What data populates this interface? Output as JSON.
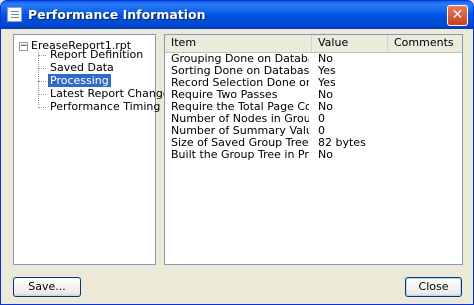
{
  "window": {
    "title": "Performance Information",
    "close_glyph": "✕"
  },
  "tree": {
    "root": {
      "label": "EreaseReport1.rpt",
      "expander": "−"
    },
    "items": [
      {
        "label": "Report Definition",
        "selected": false
      },
      {
        "label": "Saved Data",
        "selected": false
      },
      {
        "label": "Processing",
        "selected": true
      },
      {
        "label": "Latest Report Changes",
        "selected": false
      },
      {
        "label": "Performance Timing",
        "selected": false
      }
    ]
  },
  "grid": {
    "columns": [
      "Item",
      "Value",
      "Comments"
    ],
    "rows": [
      {
        "item": "Grouping Done on Database Server",
        "value": "No"
      },
      {
        "item": "Sorting Done on Database Server",
        "value": "Yes"
      },
      {
        "item": "Record Selection Done on Databa...",
        "value": "Yes"
      },
      {
        "item": "Require Two Passes",
        "value": "No"
      },
      {
        "item": "Require the Total Page Count",
        "value": "No"
      },
      {
        "item": "Number of Nodes in Group Tree",
        "value": "0"
      },
      {
        "item": "Number of Summary Values",
        "value": "0"
      },
      {
        "item": "Size of Saved Group Tree",
        "value": "82  bytes"
      },
      {
        "item": "Built the Group Tree in Progress",
        "value": "No"
      }
    ]
  },
  "buttons": {
    "save": "Save...",
    "close": "Close"
  },
  "colors": {
    "selection": "#316AC5",
    "title_bar": "#0055E5",
    "window_bg": "#ECE9D8"
  }
}
